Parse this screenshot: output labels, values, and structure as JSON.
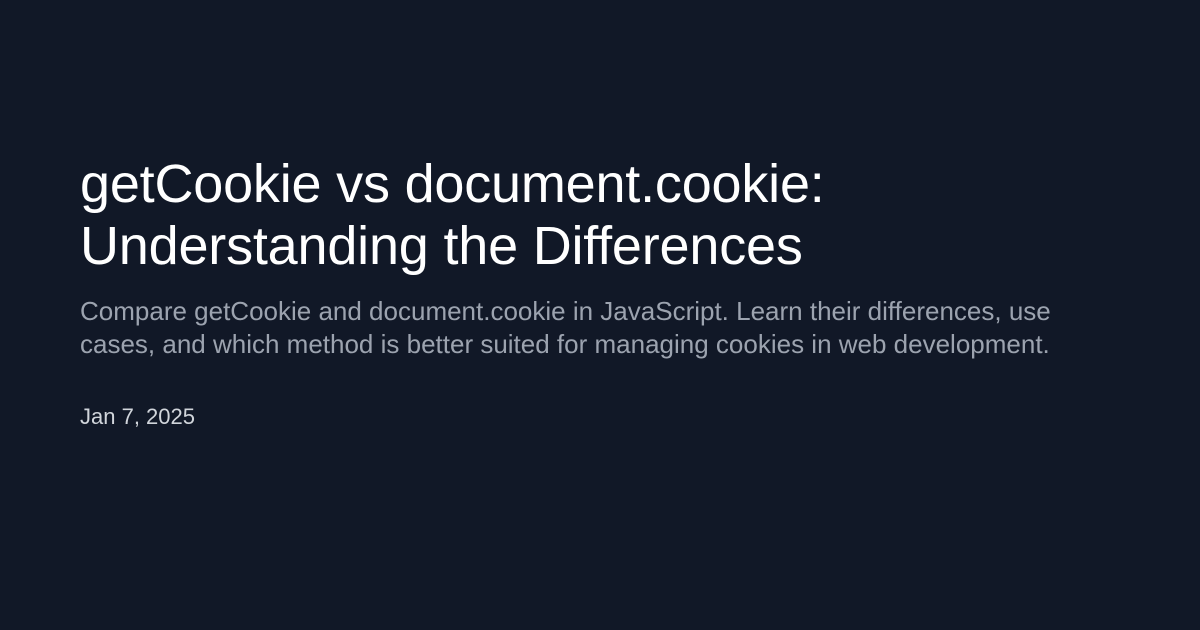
{
  "page": {
    "background_color": "#111827",
    "title_color": "#ffffff",
    "description_color": "#9ca3af",
    "date_color": "#d1d5db"
  },
  "article": {
    "title": "getCookie vs document.cookie: Understanding the Differences",
    "description": "Compare getCookie and document.cookie in JavaScript. Learn their differences, use cases, and which method is better suited for managing cookies in web development.",
    "date": "Jan 7, 2025"
  }
}
